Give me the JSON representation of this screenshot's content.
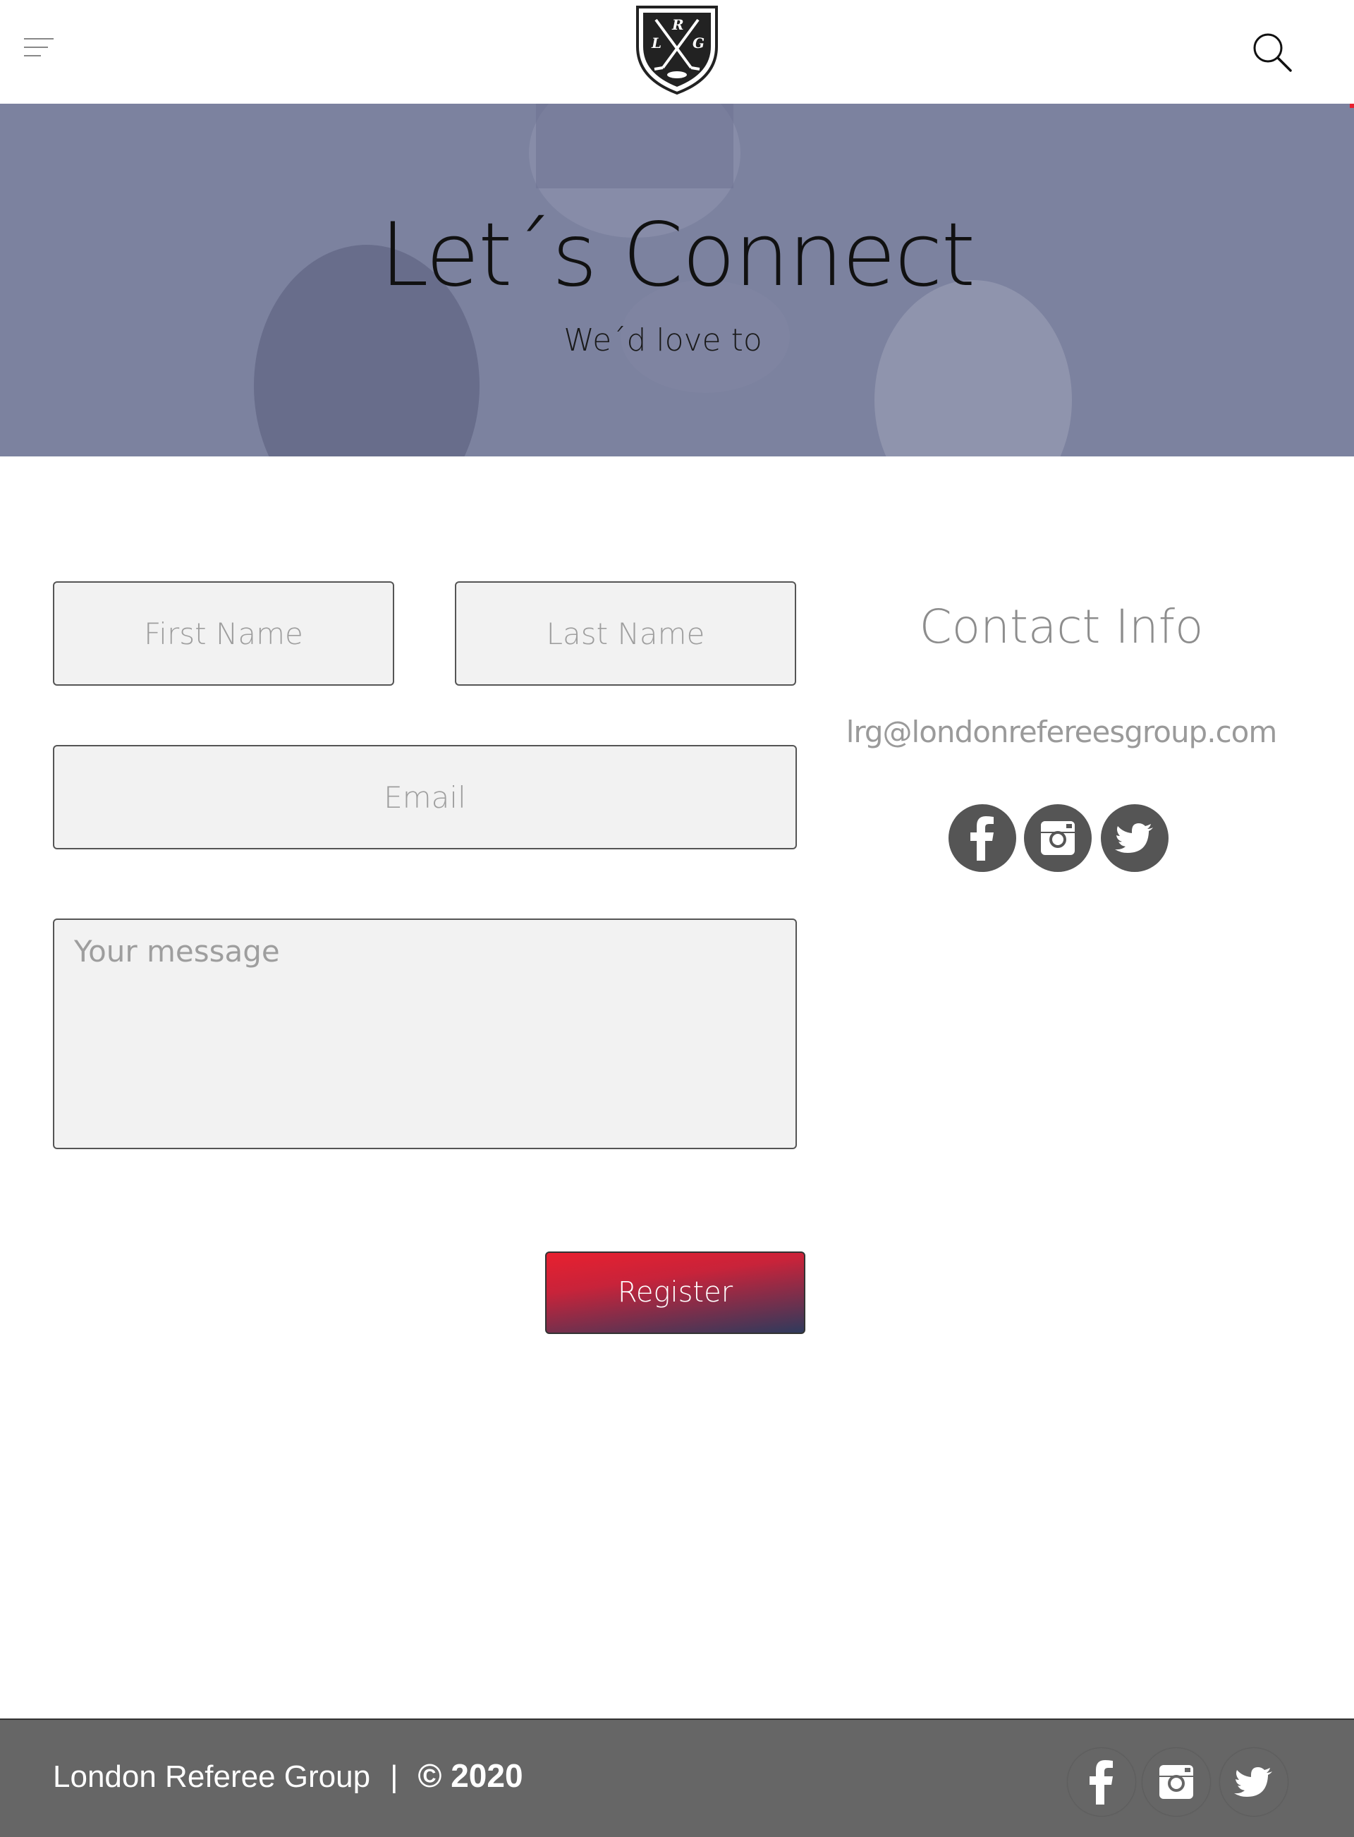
{
  "header": {
    "menu_icon": "hamburger-menu-icon",
    "logo_letters": [
      "L",
      "R",
      "G"
    ],
    "search_icon": "search-icon"
  },
  "hero": {
    "title": "Let´s Connect",
    "subtitle": "We´d love to",
    "overlay_color": "#7c829f"
  },
  "form": {
    "first_name_placeholder": "First Name",
    "last_name_placeholder": "Last Name",
    "email_placeholder": "Email",
    "message_placeholder": "Your message",
    "submit_label": "Register"
  },
  "contact": {
    "title": "Contact Info",
    "email": "lrg@londonrefereesgroup.com",
    "social": [
      "facebook-icon",
      "instagram-icon",
      "twitter-icon"
    ]
  },
  "footer": {
    "org_name": "London Referee Group",
    "separator": "|",
    "copyright": "© 2020",
    "social": [
      "facebook-icon",
      "instagram-icon",
      "twitter-icon"
    ]
  },
  "colors": {
    "button_gradient_start": "#e8202f",
    "button_gradient_end": "#2f3a5c",
    "footer_bg": "#666666",
    "social_bg": "#555555"
  }
}
